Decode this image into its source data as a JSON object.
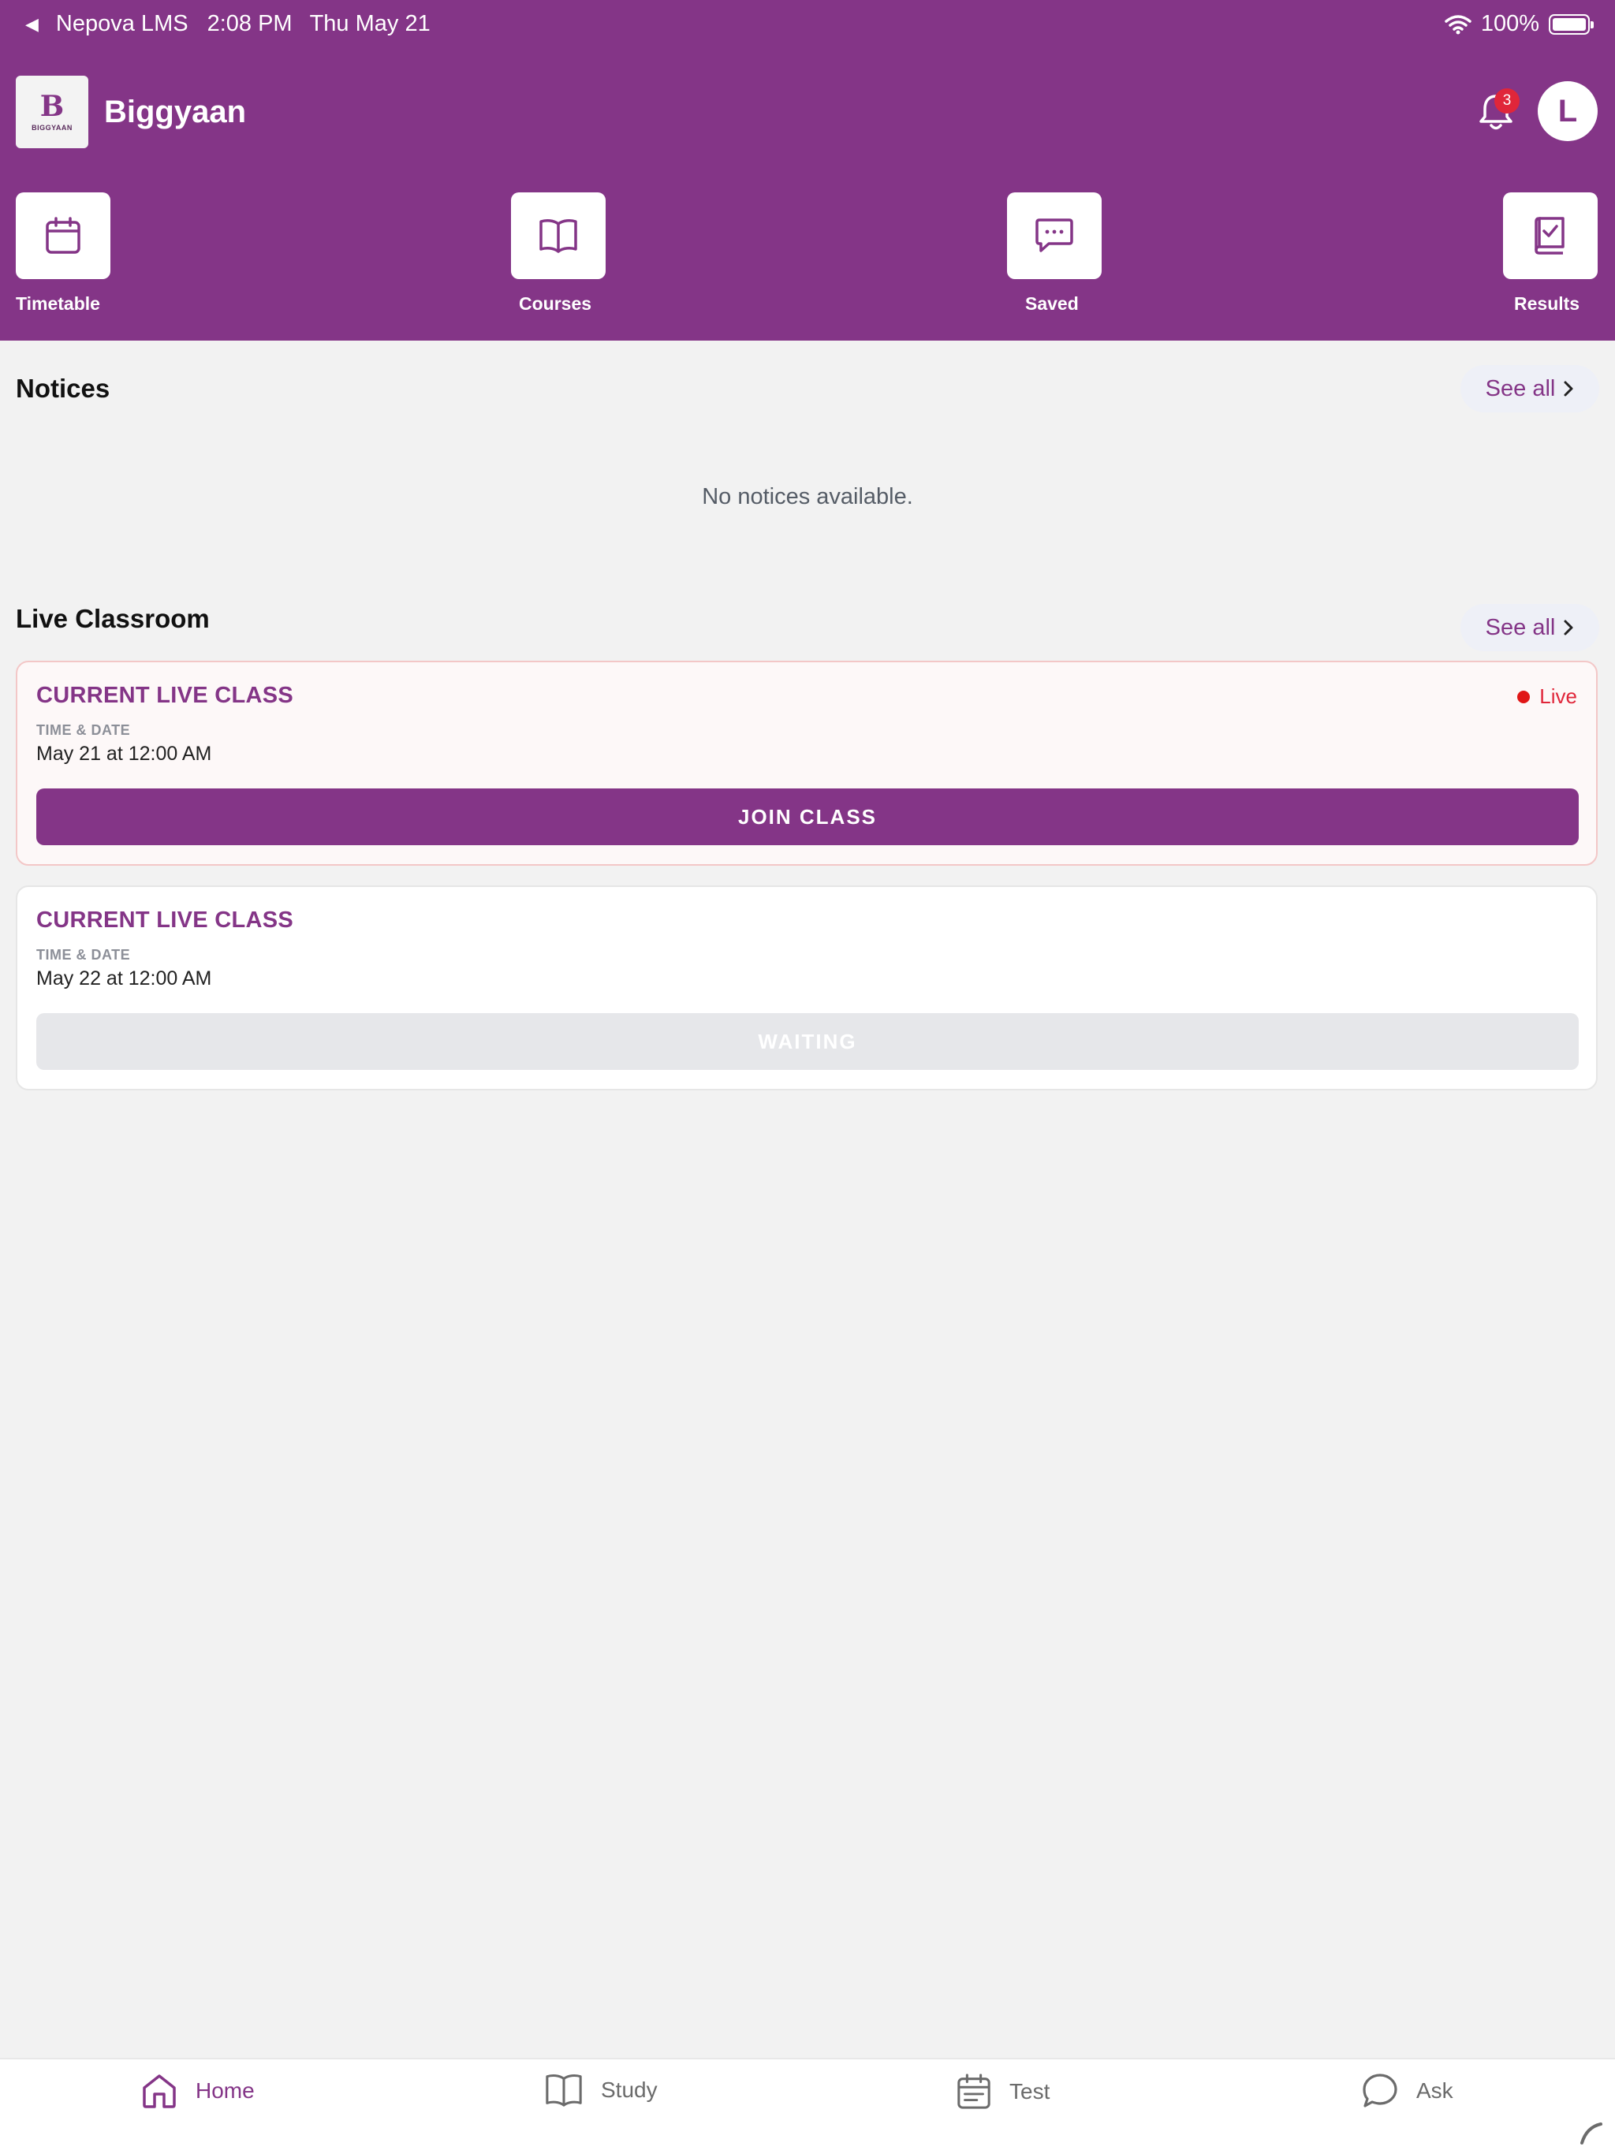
{
  "status_bar": {
    "back_app": "Nepova LMS",
    "time": "2:08 PM",
    "date": "Thu May 21",
    "battery": "100%"
  },
  "header": {
    "brand_name": "Biggyaan",
    "logo_text": "BIGGYAAN",
    "logo_letter": "B",
    "notification_count": "3",
    "avatar_initial": "L"
  },
  "quick_actions": [
    {
      "label": "Timetable",
      "icon": "calendar-icon"
    },
    {
      "label": "Courses",
      "icon": "book-icon"
    },
    {
      "label": "Saved",
      "icon": "message-icon"
    },
    {
      "label": "Results",
      "icon": "results-icon"
    }
  ],
  "notices": {
    "title": "Notices",
    "see_all": "See all",
    "empty": "No notices available."
  },
  "live_classroom": {
    "title": "Live Classroom",
    "see_all": "See all",
    "classes": [
      {
        "title": "CURRENT LIVE CLASS",
        "label": "TIME & DATE",
        "value": "May 21 at 12:00 AM",
        "status": "Live",
        "button": "JOIN CLASS"
      },
      {
        "title": "CURRENT LIVE CLASS",
        "label": "TIME & DATE",
        "value": "May 22 at 12:00 AM",
        "button": "WAITING"
      }
    ]
  },
  "tabs": [
    {
      "label": "Home",
      "icon": "home-icon",
      "active": true
    },
    {
      "label": "Study",
      "icon": "study-icon"
    },
    {
      "label": "Test",
      "icon": "test-icon"
    },
    {
      "label": "Ask",
      "icon": "chat-icon"
    }
  ],
  "colors": {
    "brand": "#843587",
    "live": "#e01616",
    "background": "#f2f2f2"
  }
}
